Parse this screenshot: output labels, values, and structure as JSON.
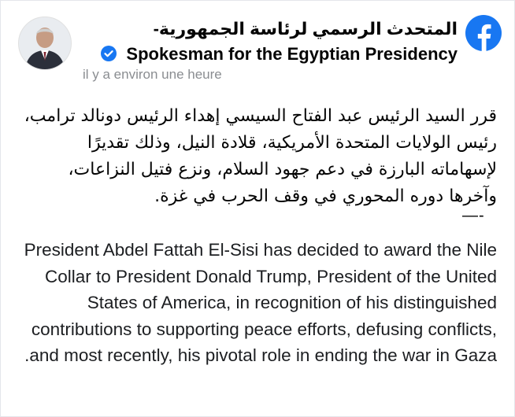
{
  "post": {
    "page_name": "المتحدث الرسمي لرئاسة الجمهورية-Spokesman for the Egyptian Presidency",
    "timestamp": "il y a environ une heure",
    "arabic_body": "قرر السيد الرئيس عبد الفتاح السيسي إهداء الرئيس دونالد ترامب، رئيس الولايات المتحدة الأمريكية، قلادة النيل، وذلك تقديرًا لإسهاماته البارزة في دعم جهود السلام، ونزع فتيل النزاعات، وآخرها دوره المحوري في وقف الحرب في غزة.",
    "separator": "—-",
    "english_body": "President Abdel Fattah El-Sisi has decided to award the Nile Collar to President Donald Trump, President of the United States of America, in recognition of his distinguished contributions to supporting peace efforts, defusing conflicts, and most recently, his pivotal role in ending the war in Gaza."
  },
  "icons": {
    "platform": "facebook-icon",
    "verified": "verified-badge-icon",
    "avatar": "profile-avatar"
  },
  "colors": {
    "facebook_blue": "#1877f2",
    "timestamp_gray": "#8a8d91",
    "text": "#050505"
  }
}
